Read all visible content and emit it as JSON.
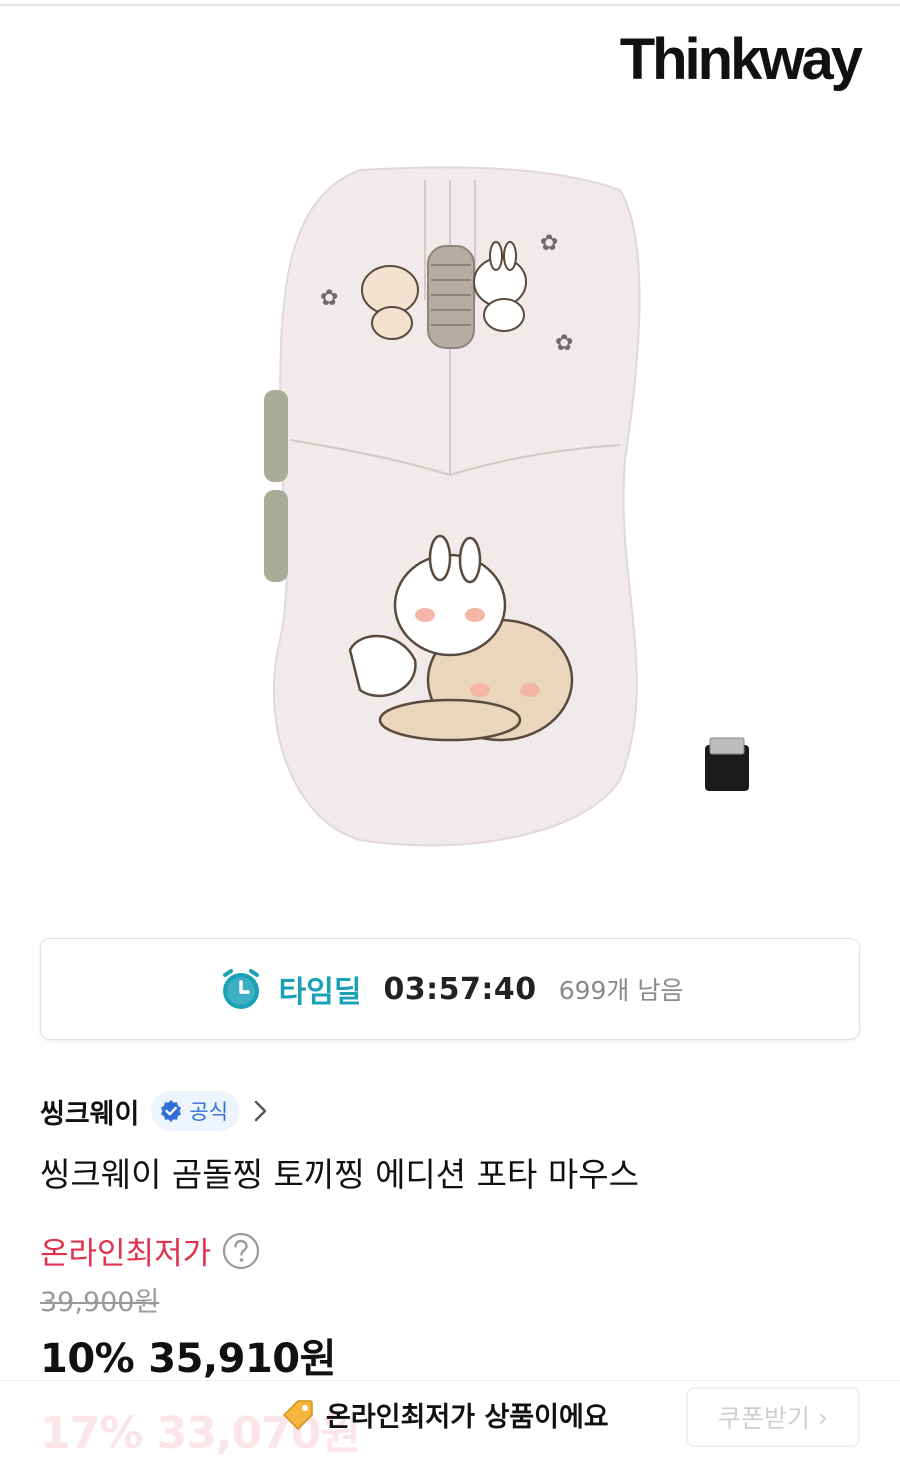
{
  "brand": {
    "logo_text": "Thinkway"
  },
  "product_image": {
    "alt": "씽크웨이 곰돌찡 토끼찡 에디션 포타 마우스",
    "icon": "mouse-product-image"
  },
  "time_deal": {
    "icon": "alarm-clock-icon",
    "label": "타임딜",
    "countdown": "03:57:40",
    "remaining": "699개 남음",
    "accent_color": "#1aa1b8"
  },
  "seller": {
    "name": "씽크웨이",
    "badge_icon": "verified-check-icon",
    "badge_label": "공식",
    "arrow_icon": "chevron-right-icon"
  },
  "product": {
    "title": "씽크웨이 곰돌찡 토끼찡 에디션 포타 마우스"
  },
  "pricing": {
    "lowest_label": "온라인최저가",
    "lowest_color": "#e0314e",
    "help_icon": "question-circle-icon",
    "original_price": "39,900원",
    "discount_percent": "10%",
    "sale_price": "35,910원"
  },
  "bottom_bar": {
    "coupon_discount_percent": "17%",
    "coupon_price": "33,070원",
    "notice_icon": "price-tag-icon",
    "notice_text": "온라인최저가 상품이에요",
    "coupon_button": "쿠폰받기"
  }
}
